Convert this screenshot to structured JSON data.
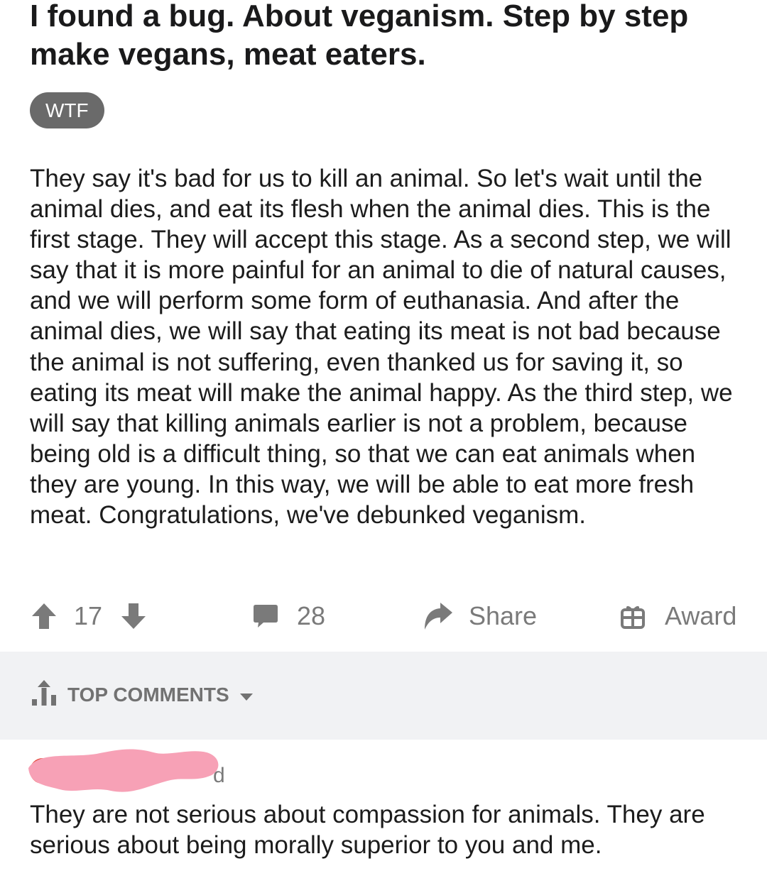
{
  "post": {
    "title": "I found a bug. About veganism. Step by step make vegans, meat eaters.",
    "flair": "WTF",
    "body": "They say it's bad for us to kill an animal. So let's wait until the animal dies, and eat its flesh when the animal dies. This is the first stage. They will accept this stage. As a second step, we will say that it is more painful for an animal to die of natural causes, and we will perform some form of euthanasia. And after the animal dies, we will say that eating its meat is not bad because the animal is not suffering, even thanked us for saving it, so eating its meat will make the animal happy. As the third step, we will say that killing animals earlier is not a problem, because being old is a difficult thing, so that we can eat animals when they are young. In this way, we will be able to eat more fresh meat. Congratulations, we've debunked veganism."
  },
  "actions": {
    "upvote_icon": "arrow-up-icon",
    "vote_count": "17",
    "downvote_icon": "arrow-down-icon",
    "comment_icon": "speech-bubble-icon",
    "comment_count": "28",
    "share_icon": "share-arrow-icon",
    "share_label": "Share",
    "award_icon": "gift-icon",
    "award_label": "Award"
  },
  "sort": {
    "icon": "bar-chart-up-icon",
    "label": "TOP COMMENTS",
    "caret_icon": "caret-down-icon"
  },
  "comments": [
    {
      "avatar_icon": "avatar",
      "username_visible_tail": "d",
      "text": "They are not serious about compassion for animals.  They are serious about being morally superior to you and me."
    }
  ],
  "colors": {
    "flair_bg": "#6a6a6a",
    "action_gray": "#7a7a7a",
    "sort_bar_bg": "#f1f2f4",
    "redaction_pink": "#f7a1b6",
    "avatar_ring": "#e44a3c"
  }
}
